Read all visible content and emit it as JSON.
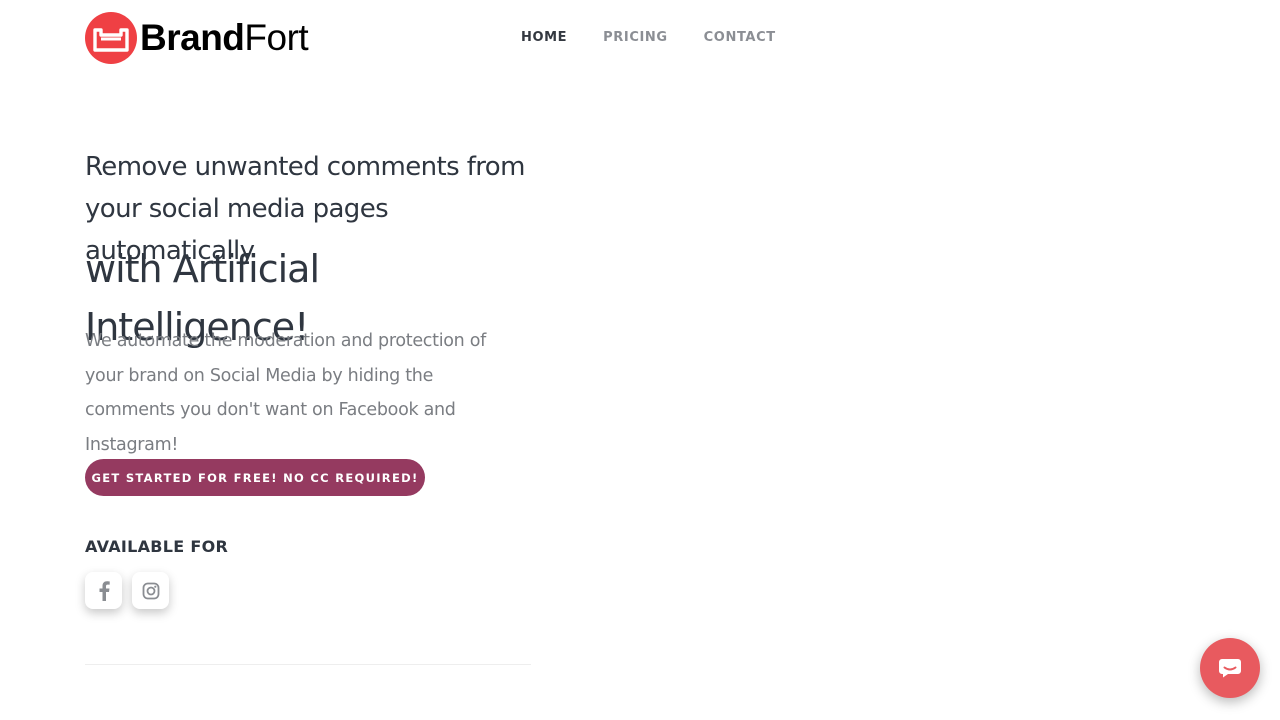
{
  "brand": {
    "name_bold": "Brand",
    "name_light": "Fort",
    "accent_color": "#ef4044"
  },
  "nav": {
    "items": [
      {
        "label": "HOME",
        "active": true
      },
      {
        "label": "PRICING",
        "active": false
      },
      {
        "label": "CONTACT",
        "active": false
      }
    ]
  },
  "hero": {
    "subheading": "Remove unwanted comments from your social media pages automatically",
    "heading": "with Artificial Intelligence!",
    "description": "We automate the moderation and protection of your brand on Social Media by hiding the comments you don't want on Facebook and Instagram!",
    "cta_label": "GET STARTED FOR FREE! NO CC REQUIRED!",
    "cta_color": "#953a60"
  },
  "availability": {
    "title": "AVAILABLE FOR",
    "platforms": [
      {
        "icon": "facebook-icon"
      },
      {
        "icon": "instagram-icon"
      }
    ]
  },
  "chat_widget": {
    "icon": "chat-icon",
    "color": "#e85a5f"
  }
}
